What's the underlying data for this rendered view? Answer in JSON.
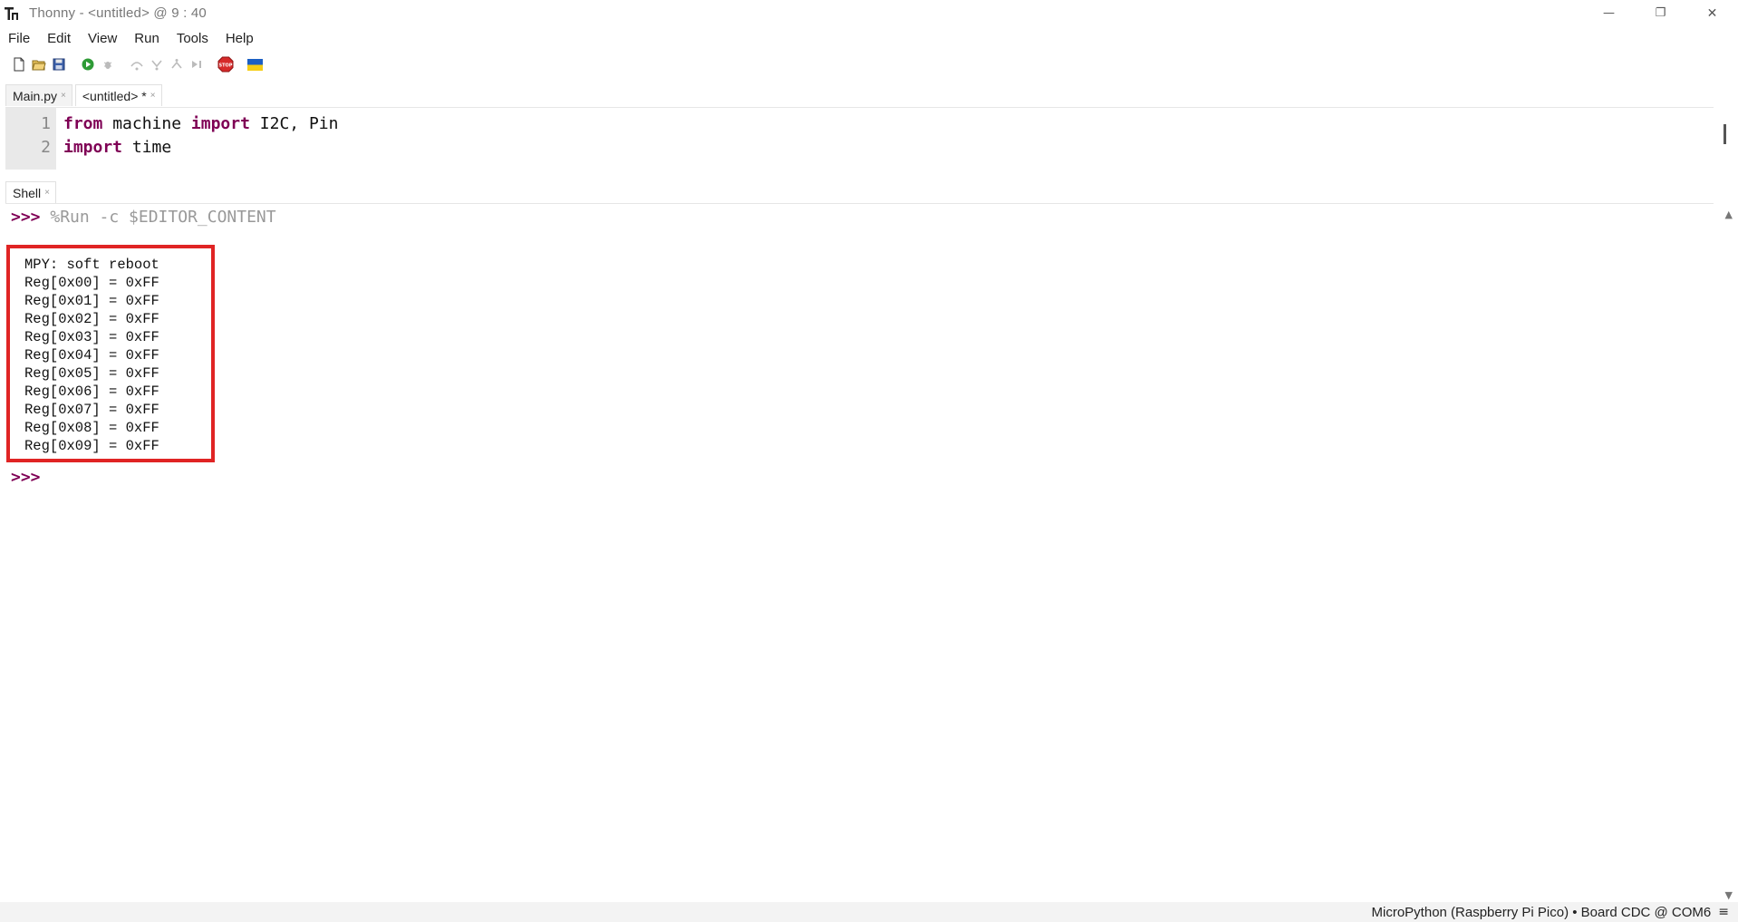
{
  "window": {
    "title": "Thonny  -  <untitled>  @  9 : 40",
    "minimize_glyph": "—",
    "restore_glyph": "❐",
    "close_glyph": "✕"
  },
  "menu": [
    "File",
    "Edit",
    "View",
    "Run",
    "Tools",
    "Help"
  ],
  "toolbar": {
    "icons": [
      "new-file-icon",
      "open-file-icon",
      "save-icon",
      "run-icon",
      "debug-icon",
      "step-over-icon",
      "step-into-icon",
      "step-out-icon",
      "resume-icon",
      "stop-icon",
      "ukraine-flag-icon"
    ]
  },
  "editor_tabs": [
    {
      "label": "Main.py",
      "close": "×",
      "active": false
    },
    {
      "label": "<untitled> *",
      "close": "×",
      "active": true
    }
  ],
  "editor": {
    "line_numbers": [
      "1",
      "2"
    ],
    "lines": [
      {
        "kw1": "from",
        "t1": " machine ",
        "kw2": "import",
        "t2": " I2C, Pin"
      },
      {
        "kw1": "import",
        "t1": " time"
      }
    ]
  },
  "shell_tab": {
    "label": "Shell",
    "close": "×"
  },
  "shell": {
    "prompt": ">>>",
    "command": " %Run -c $EDITOR_CONTENT",
    "output": [
      "MPY: soft reboot",
      "Reg[0x00] = 0xFF",
      "Reg[0x01] = 0xFF",
      "Reg[0x02] = 0xFF",
      "Reg[0x03] = 0xFF",
      "Reg[0x04] = 0xFF",
      "Reg[0x05] = 0xFF",
      "Reg[0x06] = 0xFF",
      "Reg[0x07] = 0xFF",
      "Reg[0x08] = 0xFF",
      "Reg[0x09] = 0xFF"
    ],
    "final_prompt": ">>>",
    "scroll_up": "▲",
    "scroll_down": "▼"
  },
  "status": {
    "text": "MicroPython (Raspberry Pi Pico)  •  Board CDC @ COM6",
    "menu_glyph": "≡"
  },
  "colors": {
    "highlight_box": "#e02424",
    "keyword": "#7f0055",
    "command_gray": "#999999"
  }
}
